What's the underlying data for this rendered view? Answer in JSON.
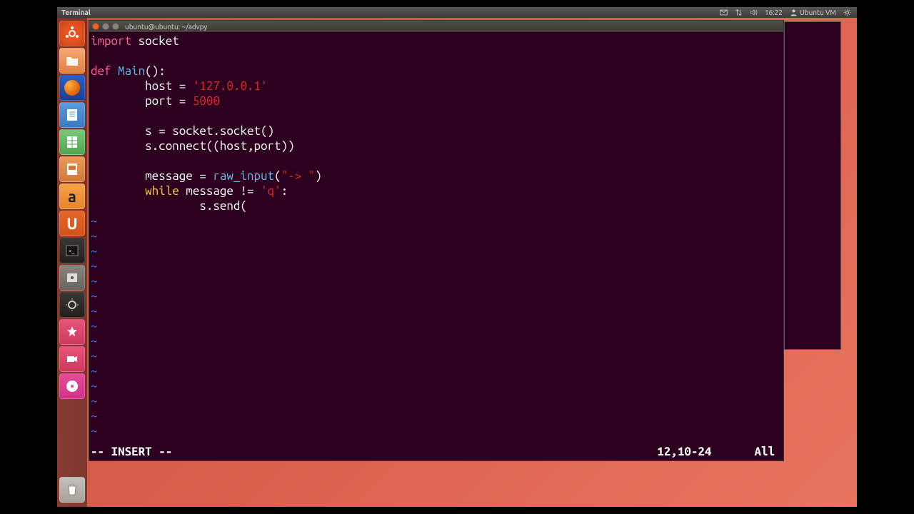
{
  "top_panel": {
    "active_app": "Terminal",
    "time": "16:22",
    "user": "Ubuntu VM",
    "icons": [
      "mail",
      "network",
      "volume",
      "time",
      "user",
      "gear"
    ]
  },
  "launcher": {
    "items": [
      {
        "name": "dash",
        "glyph": "⌂"
      },
      {
        "name": "files",
        "glyph": "📁"
      },
      {
        "name": "firefox",
        "glyph": ""
      },
      {
        "name": "writer",
        "glyph": "📄"
      },
      {
        "name": "calc",
        "glyph": "📊"
      },
      {
        "name": "impress",
        "glyph": "📽"
      },
      {
        "name": "amazon",
        "glyph": "a"
      },
      {
        "name": "ubuntu-one",
        "glyph": "U"
      },
      {
        "name": "terminal",
        "glyph": ">_"
      },
      {
        "name": "settings",
        "glyph": "⚙"
      },
      {
        "name": "system",
        "glyph": "⚙"
      },
      {
        "name": "cheese",
        "glyph": "✦"
      },
      {
        "name": "recorder",
        "glyph": "■"
      },
      {
        "name": "dvd",
        "glyph": "◉"
      },
      {
        "name": "trash",
        "glyph": "🗑"
      }
    ]
  },
  "terminal": {
    "title": "ubuntu@ubuntu: ~/advpy",
    "code": {
      "l1_import": "import",
      "l1_socket": " socket",
      "l3_def": "def",
      "l3_main": " Main",
      "l3_rest": "():",
      "l4_pre": "        host = ",
      "l4_str": "'127.0.0.1'",
      "l5_pre": "        port = ",
      "l5_num": "5000",
      "l7": "        s = socket.socket()",
      "l8": "        s.connect((host,port))",
      "l10_pre": "        message = ",
      "l10_fn": "raw_input",
      "l10_paren": "(",
      "l10_str": "\"-> \"",
      "l10_end": ")",
      "l11_indent": "        ",
      "l11_while": "while",
      "l11_mid": " message != ",
      "l11_str": "'q'",
      "l11_end": ":",
      "l12": "                s.send("
    },
    "tilde": "~",
    "status": {
      "mode": "-- INSERT --",
      "pos": "12,10-24",
      "all": "All"
    }
  }
}
